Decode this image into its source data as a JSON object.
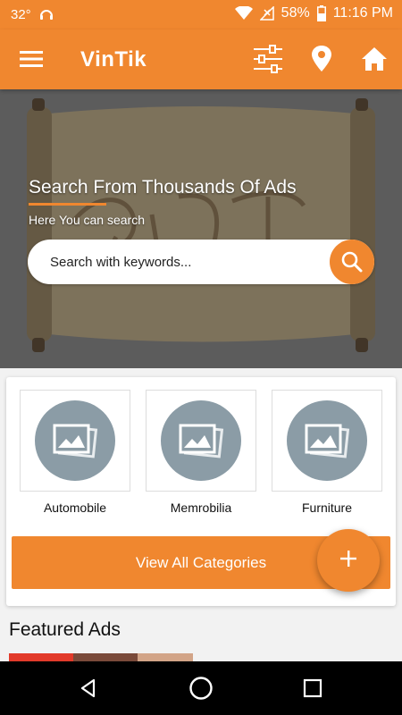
{
  "status_bar": {
    "temperature": "32°",
    "battery": "58%",
    "time": "11:16 PM"
  },
  "app_bar": {
    "title": "VinTik",
    "icons": [
      "menu-icon",
      "filter-icon",
      "location-pin-icon",
      "home-icon"
    ]
  },
  "hero": {
    "heading": "Search From Thousands Of Ads",
    "subheading": "Here You can search",
    "search_placeholder": "Search with keywords...",
    "search_icon": "search-icon"
  },
  "categories": {
    "items": [
      {
        "label": "Automobile",
        "icon": "image-placeholder-icon"
      },
      {
        "label": "Memrobilia",
        "icon": "image-placeholder-icon"
      },
      {
        "label": "Furniture",
        "icon": "image-placeholder-icon"
      }
    ],
    "view_all_label": "View All Categories",
    "fab_label": "+"
  },
  "featured": {
    "title": "Featured Ads"
  },
  "colors": {
    "accent": "#f0872f",
    "placeholder_circle": "#8b9ca6",
    "nav_bar": "#000000"
  }
}
